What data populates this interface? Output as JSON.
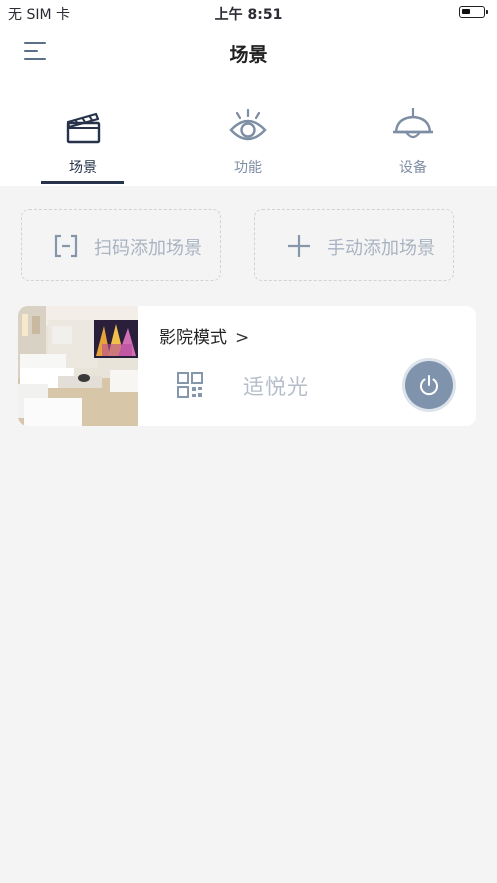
{
  "status_bar": {
    "carrier": "无 SIM 卡",
    "time": "上午 8:51"
  },
  "nav": {
    "title": "场景",
    "menu_icon": "hamburger-menu-icon"
  },
  "tabs": [
    {
      "label": "场景",
      "icon": "clapperboard-icon",
      "active": true
    },
    {
      "label": "功能",
      "icon": "eye-icon",
      "active": false
    },
    {
      "label": "设备",
      "icon": "ceiling-lamp-icon",
      "active": false
    }
  ],
  "actions": {
    "scan_add_label": "扫码添加场景",
    "scan_add_icon": "scan-bracket-icon",
    "manual_add_label": "手动添加场景",
    "manual_add_icon": "plus-icon"
  },
  "scenes": [
    {
      "name": "影院模式",
      "mode": "适悦光",
      "thumbnail": "living-room-cinema-photo",
      "qr_icon": "qr-code-icon",
      "power_icon": "power-icon"
    }
  ],
  "colors": {
    "accent_dark": "#26334a",
    "icon_blue_gray": "#7e8ea4",
    "power_button": "#7f93ad",
    "background": "#f4f4f5"
  }
}
